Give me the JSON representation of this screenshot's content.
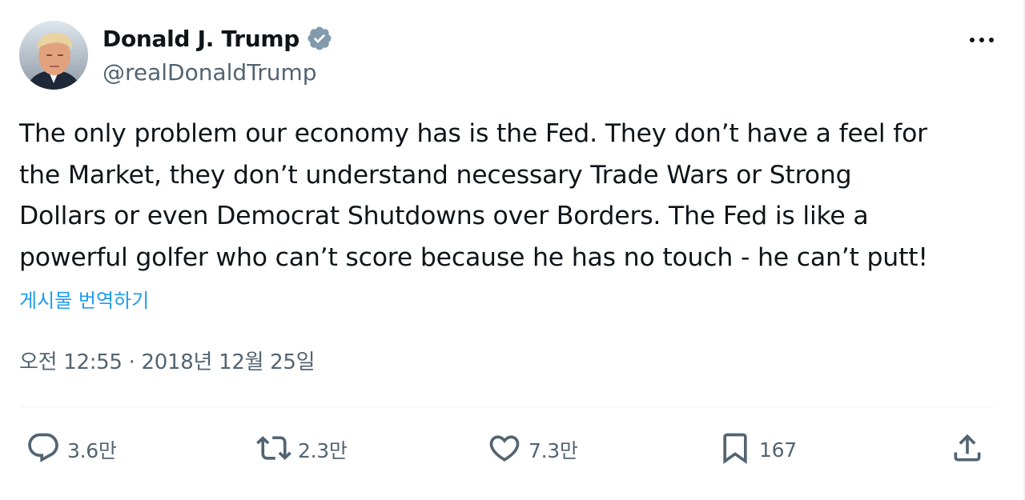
{
  "author": {
    "display_name": "Donald J. Trump",
    "handle": "@realDonaldTrump",
    "verified": true
  },
  "tweet": {
    "lines": [
      "The only problem our economy has is the Fed. They don’t have a feel for",
      "the Market, they don’t understand necessary Trade Wars or Strong",
      "Dollars or even Democrat Shutdowns over Borders. The Fed is like a",
      "powerful golfer who can’t score because he has no touch - he can’t putt!"
    ],
    "translate_link": "게시물 번역하기",
    "timestamp": "오전 12:55 · 2018년 12월 25일"
  },
  "actions": {
    "replies": "3.6만",
    "reposts": "2.3만",
    "likes": "7.3만",
    "bookmarks": "167"
  },
  "colors": {
    "text": "#0f1419",
    "secondary": "#536471",
    "link": "#1d9bf0",
    "verified": "#829aab",
    "divider": "#eff3f4"
  },
  "icons": [
    "verified-badge-icon",
    "more-icon",
    "reply-icon",
    "repost-icon",
    "like-icon",
    "bookmark-icon",
    "share-icon"
  ]
}
